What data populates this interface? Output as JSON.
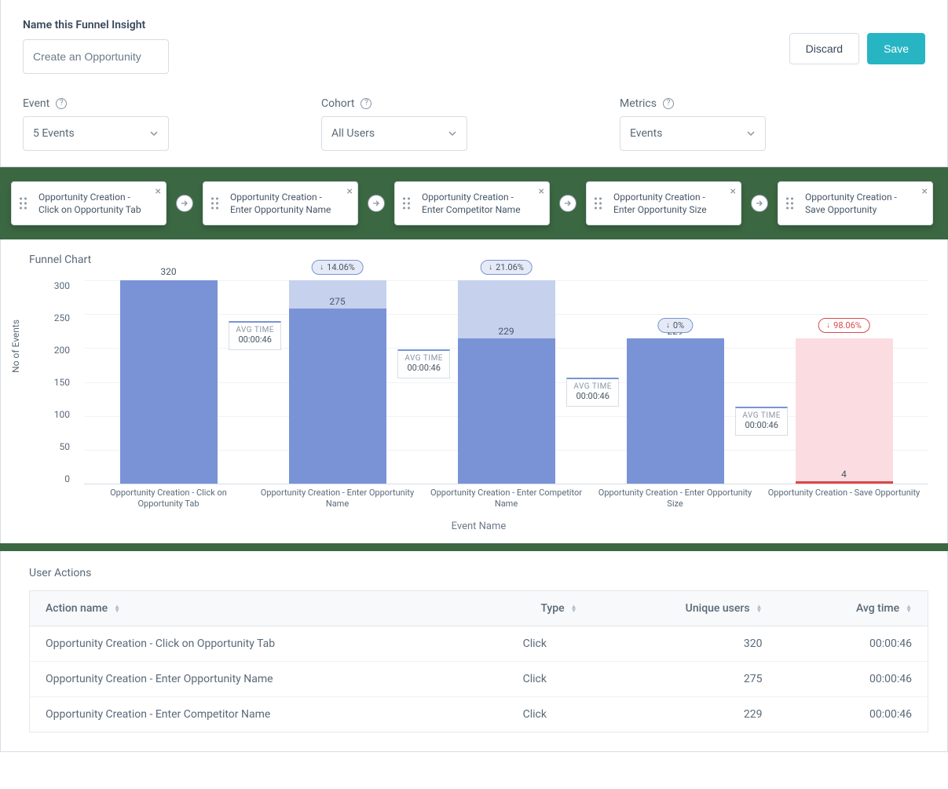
{
  "header": {
    "title": "Name this Funnel Insight",
    "name_value": "Create an Opportunity",
    "discard_label": "Discard",
    "save_label": "Save"
  },
  "filters": {
    "event_label": "Event",
    "event_value": "5 Events",
    "cohort_label": "Cohort",
    "cohort_value": "All Users",
    "metrics_label": "Metrics",
    "metrics_value": "Events"
  },
  "steps": [
    {
      "label": "Opportunity Creation - Click on Opportunity Tab"
    },
    {
      "label": "Opportunity Creation - Enter Opportunity Name"
    },
    {
      "label": "Opportunity Creation - Enter Competitor Name"
    },
    {
      "label": "Opportunity Creation - Enter Opportunity Size"
    },
    {
      "label": "Opportunity Creation - Save Opportunity"
    }
  ],
  "chart_data": {
    "type": "bar",
    "title": "Funnel Chart",
    "xlabel": "Event Name",
    "ylabel": "No of  Events",
    "ylim": [
      0,
      320
    ],
    "y_ticks": [
      "300",
      "250",
      "200",
      "150",
      "100",
      "50",
      "0"
    ],
    "categories": [
      "Opportunity Creation - Click on Opportunity Tab",
      "Opportunity Creation - Enter Opportunity Name",
      "Opportunity Creation - Enter Competitor Name",
      "Opportunity Creation - Enter Opportunity Size",
      "Opportunity Creation - Save Opportunity"
    ],
    "series": [
      {
        "name": "events",
        "values": [
          320,
          275,
          229,
          229,
          4
        ]
      }
    ],
    "conversion_drop": {
      "labels": [
        "14.06%",
        "21.06%",
        "0%",
        "98.06%"
      ],
      "from_prev": [
        320,
        320,
        229,
        229
      ]
    },
    "avg_time": {
      "label": "AVG TIME",
      "values": [
        "00:00:46",
        "00:00:46",
        "00:00:46",
        "00:00:46"
      ]
    }
  },
  "table": {
    "title": "User Actions",
    "headers": {
      "action": "Action name",
      "type": "Type",
      "users": "Unique users",
      "time": "Avg time"
    },
    "rows": [
      {
        "action": "Opportunity Creation - Click on Opportunity Tab",
        "type": "Click",
        "users": "320",
        "time": "00:00:46"
      },
      {
        "action": "Opportunity Creation - Enter Opportunity Name",
        "type": "Click",
        "users": "275",
        "time": "00:00:46"
      },
      {
        "action": "Opportunity Creation - Enter Competitor Name",
        "type": "Click",
        "users": "229",
        "time": "00:00:46"
      }
    ]
  }
}
